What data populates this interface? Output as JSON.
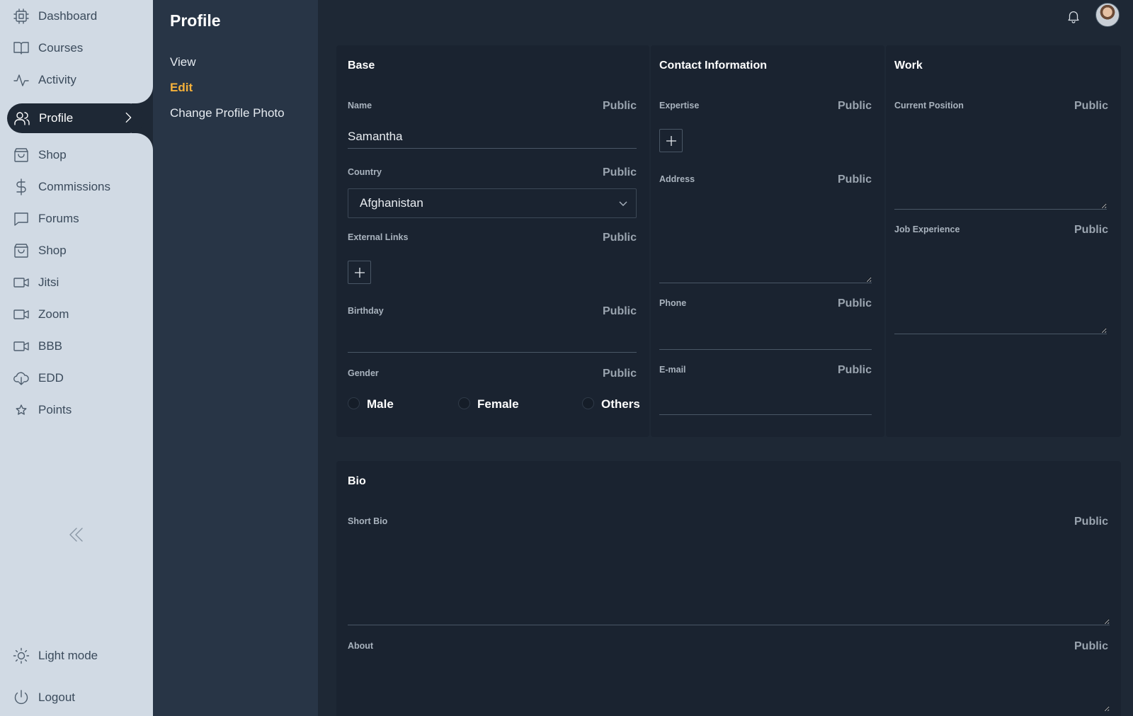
{
  "sidebar": {
    "items": [
      {
        "label": "Dashboard",
        "icon": "chip-icon"
      },
      {
        "label": "Courses",
        "icon": "book-icon"
      },
      {
        "label": "Activity",
        "icon": "activity-icon"
      },
      {
        "label": "Profile",
        "icon": "users-icon"
      },
      {
        "label": "Shop",
        "icon": "bag-icon"
      },
      {
        "label": "Commissions",
        "icon": "dollar-icon"
      },
      {
        "label": "Forums",
        "icon": "chat-icon"
      },
      {
        "label": "Shop",
        "icon": "bag-icon"
      },
      {
        "label": "Jitsi",
        "icon": "video-icon"
      },
      {
        "label": "Zoom",
        "icon": "video-icon"
      },
      {
        "label": "BBB",
        "icon": "video-icon"
      },
      {
        "label": "EDD",
        "icon": "cloud-download-icon"
      },
      {
        "label": "Points",
        "icon": "star-icon"
      }
    ],
    "active": "Profile",
    "light_mode": "Light mode",
    "logout": "Logout"
  },
  "subnav": {
    "title": "Profile",
    "links": [
      "View",
      "Edit",
      "Change Profile Photo"
    ],
    "active": "Edit"
  },
  "visibility_label": "Public",
  "base": {
    "title": "Base",
    "name_label": "Name",
    "name_value": "Samantha",
    "country_label": "Country",
    "country_value": "Afghanistan",
    "links_label": "External Links",
    "birthday_label": "Birthday",
    "birthday_value": "",
    "gender_label": "Gender",
    "gender_options": [
      "Male",
      "Female",
      "Others"
    ]
  },
  "contact": {
    "title": "Contact Information",
    "expertise_label": "Expertise",
    "address_label": "Address",
    "phone_label": "Phone",
    "phone_value": "",
    "email_label": "E-mail",
    "email_value": ""
  },
  "work": {
    "title": "Work",
    "position_label": "Current Position",
    "experience_label": "Job Experience"
  },
  "bio": {
    "title": "Bio",
    "short_bio_label": "Short Bio",
    "about_label": "About"
  },
  "colors": {
    "sidebar_bg": "#d1dae4",
    "subpanel_bg": "#283546",
    "page_bg": "#1e2835",
    "card_bg": "#1a2330",
    "accent": "#f5b13b"
  }
}
